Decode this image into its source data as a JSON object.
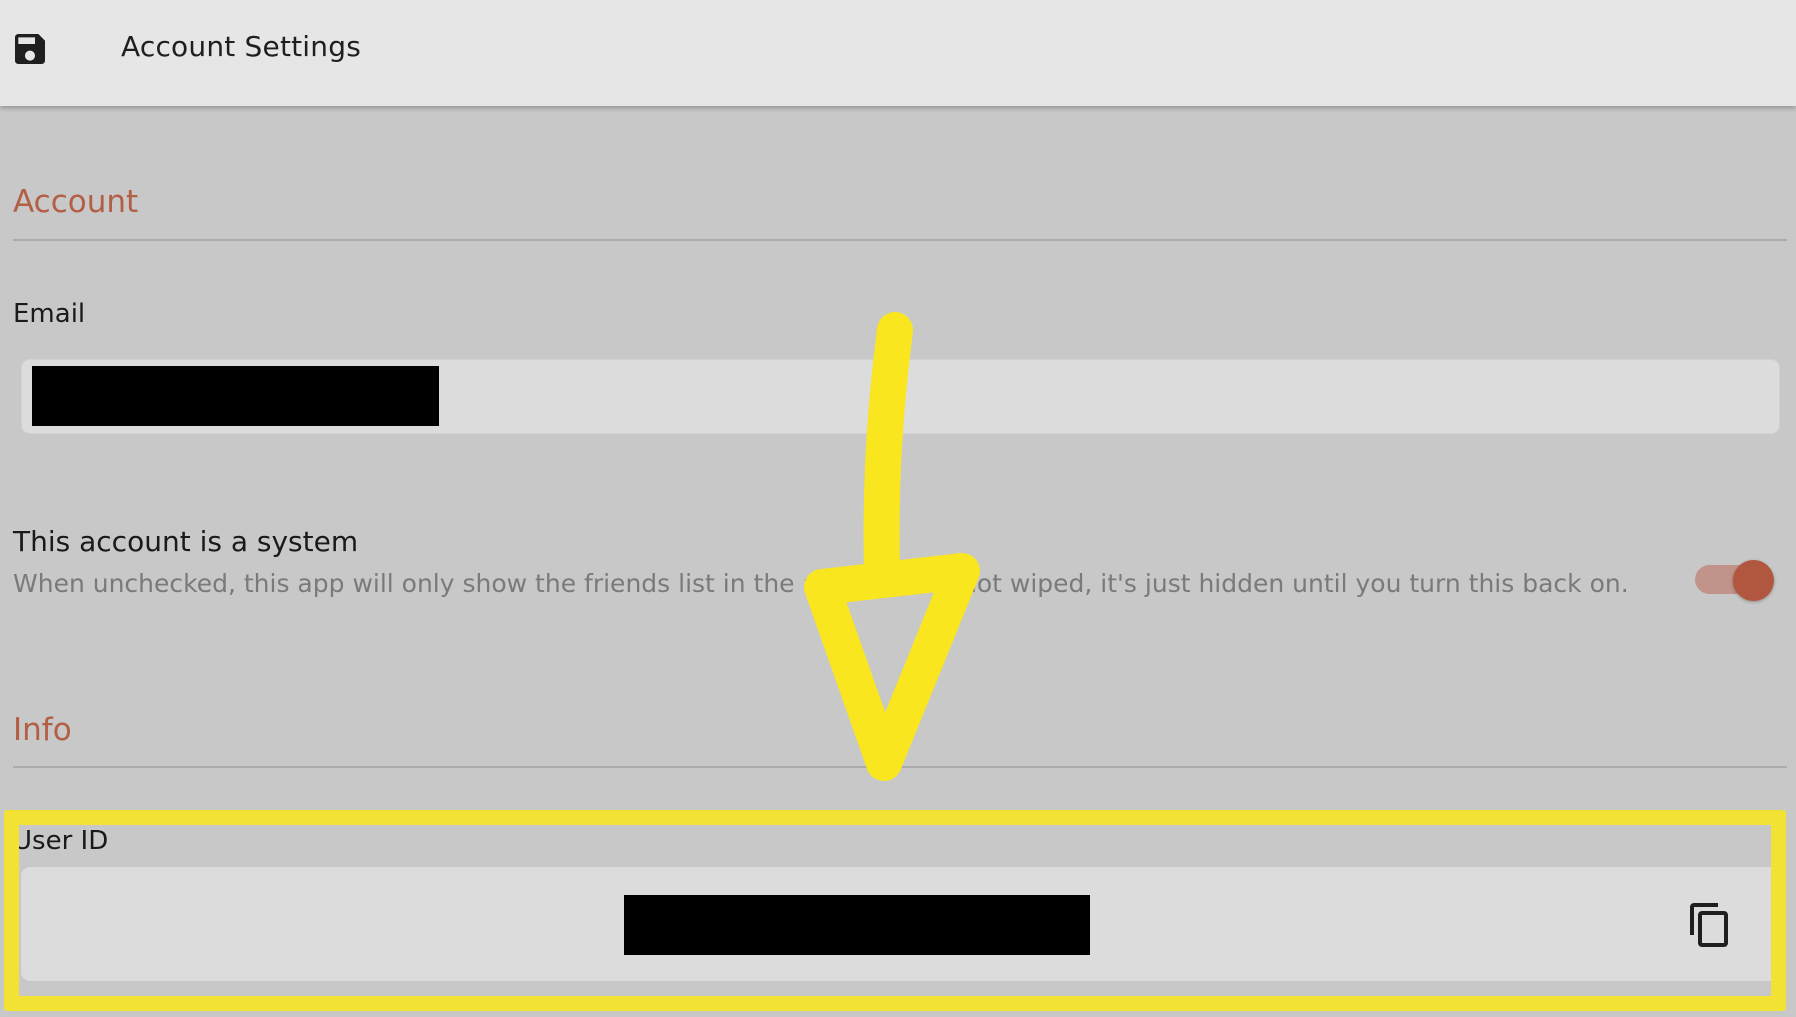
{
  "header": {
    "title": "Account Settings",
    "save_icon": "save-icon"
  },
  "account_section": {
    "title": "Account",
    "email_label": "Email",
    "email_value": "[redacted]"
  },
  "system_toggle": {
    "title": "This account is a system",
    "description": "When unchecked, this app will only show the friends list in the app. Data is not wiped, it's just hidden until you turn this back on.",
    "checked": true
  },
  "info_section": {
    "title": "Info",
    "user_id_label": "User ID",
    "user_id_value": "[redacted]",
    "copy_icon": "copy-icon"
  },
  "annotation": {
    "highlight_color": "#f2e233",
    "arrow_color": "#f9e61e"
  },
  "colors": {
    "accent": "#b25f45",
    "header_bg": "#e6e6e6",
    "page_bg": "#c8c8c8",
    "field_bg": "#dcdcdc"
  }
}
